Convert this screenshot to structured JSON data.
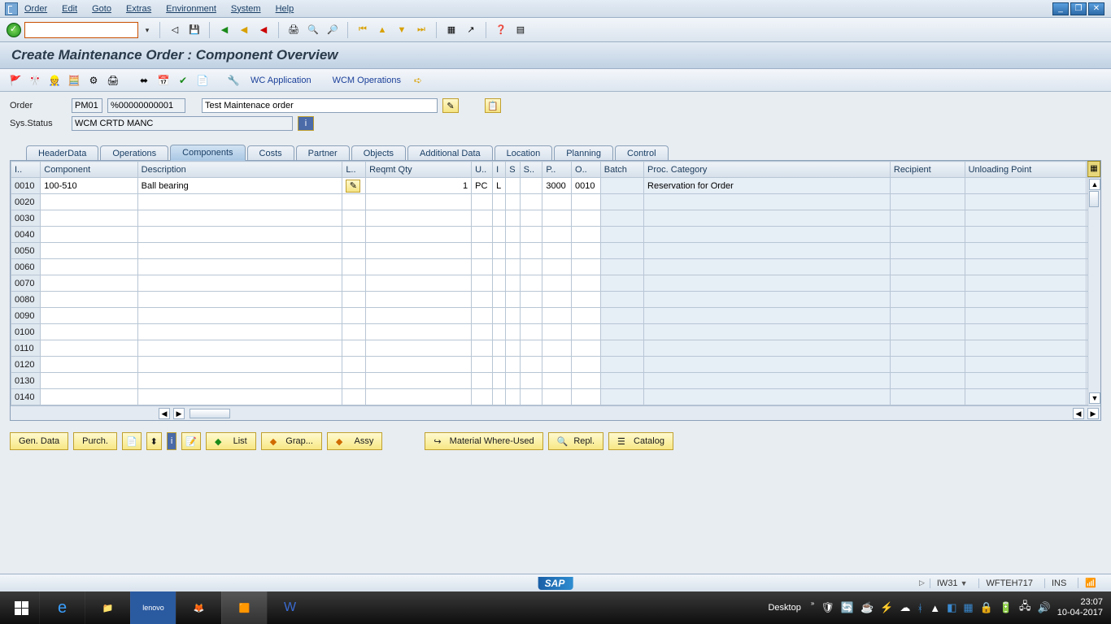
{
  "menu": {
    "items": [
      "Order",
      "Edit",
      "Goto",
      "Extras",
      "Environment",
      "System",
      "Help"
    ]
  },
  "title": "Create Maintenance Order : Component Overview",
  "appToolbar": {
    "wcLink": "WC Application",
    "wcmLink": "WCM Operations"
  },
  "form": {
    "orderLabel": "Order",
    "orderType": "PM01",
    "orderNum": "%00000000001",
    "orderDesc": "Test Maintenace order",
    "statusLabel": "Sys.Status",
    "statusVal": "WCM   CRTD  MANC"
  },
  "tabs": [
    "HeaderData",
    "Operations",
    "Components",
    "Costs",
    "Partner",
    "Objects",
    "Additional Data",
    "Location",
    "Planning",
    "Control"
  ],
  "activeTab": 2,
  "table": {
    "headers": [
      "I..",
      "Component",
      "Description",
      "L..",
      "Reqmt Qty",
      "U..",
      "I",
      "S",
      "S..",
      "P..",
      "O..",
      "Batch",
      "Proc. Category",
      "Recipient",
      "Unloading Point"
    ],
    "widths": [
      34,
      112,
      236,
      24,
      122,
      24,
      14,
      14,
      26,
      30,
      30,
      50,
      284,
      86,
      140
    ],
    "rows": [
      {
        "num": "0010",
        "component": "100-510",
        "description": "Ball bearing",
        "l": "",
        "qty": "1",
        "uom": "PC",
        "i": "L",
        "s": "",
        "ss": "",
        "p": "3000",
        "o": "0010",
        "batch": "",
        "proc": "Reservation for Order",
        "recipient": "",
        "unload": ""
      },
      {
        "num": "0020"
      },
      {
        "num": "0030"
      },
      {
        "num": "0040"
      },
      {
        "num": "0050"
      },
      {
        "num": "0060"
      },
      {
        "num": "0070"
      },
      {
        "num": "0080"
      },
      {
        "num": "0090"
      },
      {
        "num": "0100"
      },
      {
        "num": "0110"
      },
      {
        "num": "0120"
      },
      {
        "num": "0130"
      },
      {
        "num": "0140"
      }
    ]
  },
  "bottomButtons": {
    "genData": "Gen. Data",
    "purch": "Purch.",
    "list": "List",
    "grap": "Grap...",
    "assy": "Assy",
    "mwu": "Material Where-Used",
    "repl": "Repl.",
    "catalog": "Catalog"
  },
  "status": {
    "tcode": "IW31",
    "server": "WFTEH717",
    "mode": "INS"
  },
  "taskbar": {
    "desktop": "Desktop",
    "time": "23:07",
    "date": "10-04-2017"
  }
}
